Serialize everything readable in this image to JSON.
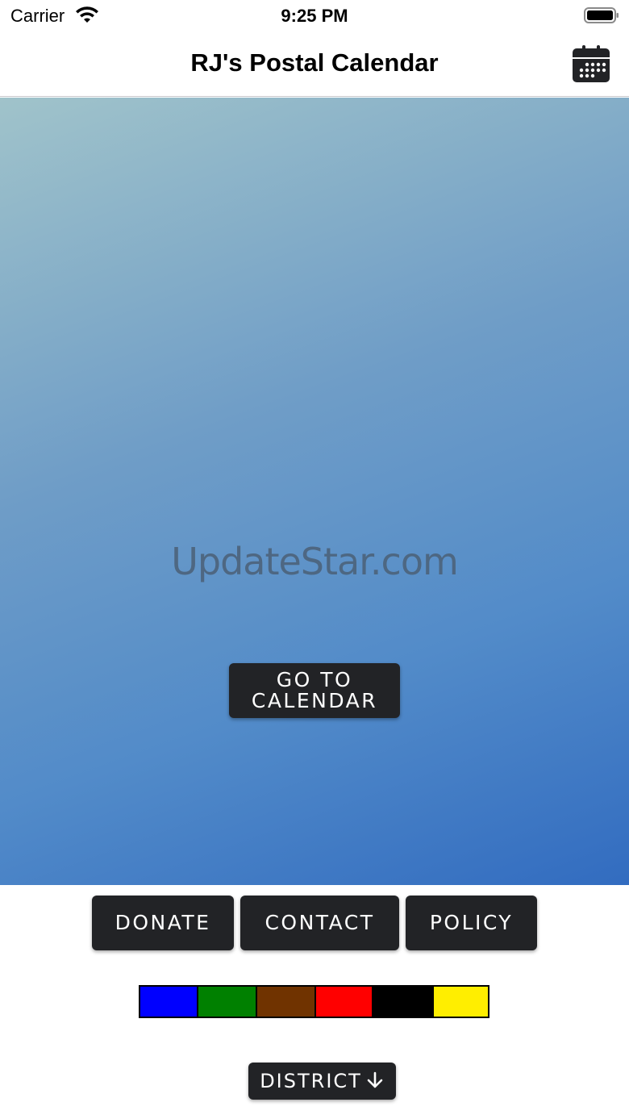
{
  "status_bar": {
    "carrier": "Carrier",
    "time": "9:25 PM",
    "wifi_icon": "wifi-icon",
    "battery_icon": "battery-icon"
  },
  "nav": {
    "title": "RJ's Postal Calendar",
    "calendar_icon": "calendar-icon"
  },
  "hero": {
    "watermark": "UpdateStar.com",
    "go_to_calendar_line1": "GO TO",
    "go_to_calendar_line2": "CALENDAR"
  },
  "footer": {
    "donate_label": "DONATE",
    "contact_label": "CONTACT",
    "policy_label": "POLICY",
    "district_label": "DISTRICT",
    "district_icon": "arrow-down-icon"
  },
  "color_swatches": [
    {
      "color": "#0000ff"
    },
    {
      "color": "#008000"
    },
    {
      "color": "#703300"
    },
    {
      "color": "#ff0000"
    },
    {
      "color": "#000000"
    },
    {
      "color": "#ffee00"
    }
  ],
  "colors": {
    "button_bg": "#222326",
    "gradient_start": "#a0c3ca",
    "gradient_end": "#326cc0"
  }
}
